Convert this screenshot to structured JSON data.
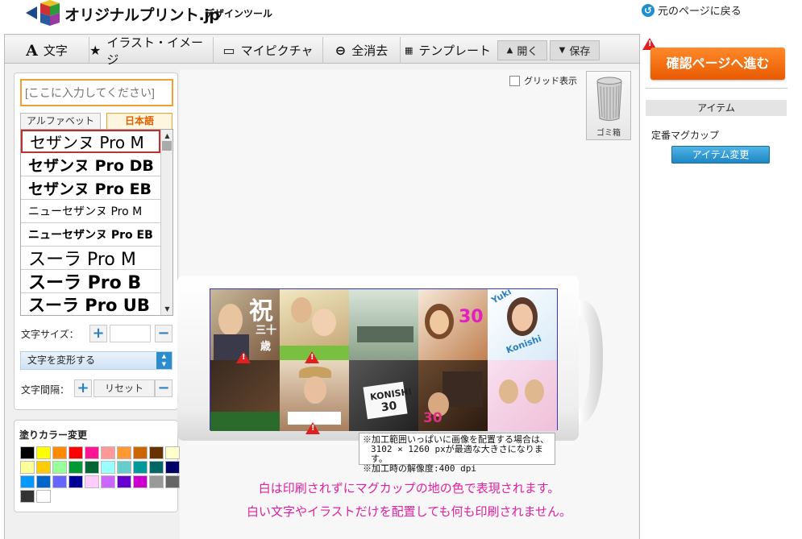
{
  "header": {
    "logo_text": "オリジナルプリント.jp",
    "logo_sub": "デザインツール",
    "back_link": "元のページに戻る"
  },
  "toolbar": {
    "text_label": "文字",
    "illust_label": "イラスト・イメージ",
    "mypicture_label": "マイピクチャ",
    "clear_label": "全消去",
    "template_label": "テンプレート",
    "open_label": "開く",
    "save_label": "保存"
  },
  "left_panel": {
    "text_input_placeholder": "[ここに入力してください]",
    "tab_alphabet": "アルファベット",
    "tab_japanese": "日本語",
    "fonts": [
      {
        "label": "セザンヌ Pro M"
      },
      {
        "label": "セザンヌ Pro DB"
      },
      {
        "label": "セザンヌ Pro EB"
      },
      {
        "label": "ニューセザンヌ Pro M"
      },
      {
        "label": "ニューセザンヌ Pro EB"
      },
      {
        "label": "スーラ Pro M"
      },
      {
        "label": "スーラ Pro B"
      },
      {
        "label": "スーラ Pro UB"
      }
    ],
    "selected_font_index": 0,
    "font_size_label": "文字サイズ：",
    "font_size_value": "",
    "transform_label": "文字を変形する",
    "spacing_label": "文字間隔：",
    "reset_label": "リセット"
  },
  "color_panel": {
    "title": "塗りカラー変更",
    "swatches": [
      "#000000",
      "#ffff00",
      "#ff8c00",
      "#ff0000",
      "#ff1493",
      "#ff9999",
      "#ff9933",
      "#cc6600",
      "#663300",
      "#ffffcc",
      "#ffff99",
      "#ffcc00",
      "#99ff99",
      "#009933",
      "#006633",
      "#99ffff",
      "#66cccc",
      "#009999",
      "#006666",
      "#000066",
      "#0099ff",
      "#0066cc",
      "#6666ff",
      "#000099",
      "#ffccff",
      "#cc66ff",
      "#6600cc",
      "#cc00cc",
      "#999999",
      "#666666",
      "#333333",
      "#ffffff"
    ]
  },
  "canvas": {
    "grid_label": "グリッド表示",
    "trash_label": "ゴミ箱",
    "cell_texts": [
      "祝",
      "三十",
      "歳",
      "30",
      "Yuki",
      "Konishi",
      "KONISHI",
      "30",
      "30"
    ],
    "note_lines": [
      "※加工範囲いっぱいに画像を配置する場合は、",
      "3102 × 1260 pxが最適な大きさになります。",
      "※加工時の解像度:400 dpi"
    ],
    "message_line1": "白は印刷されずにマグカップの地の色で表現されます。",
    "message_line2": "白い文字やイラストだけを配置しても何も印刷されません。"
  },
  "right_panel": {
    "confirm_label": "確認ページへ進む",
    "item_heading": "アイテム",
    "item_name": "定番マグカップ",
    "item_change_label": "アイテム変更"
  }
}
